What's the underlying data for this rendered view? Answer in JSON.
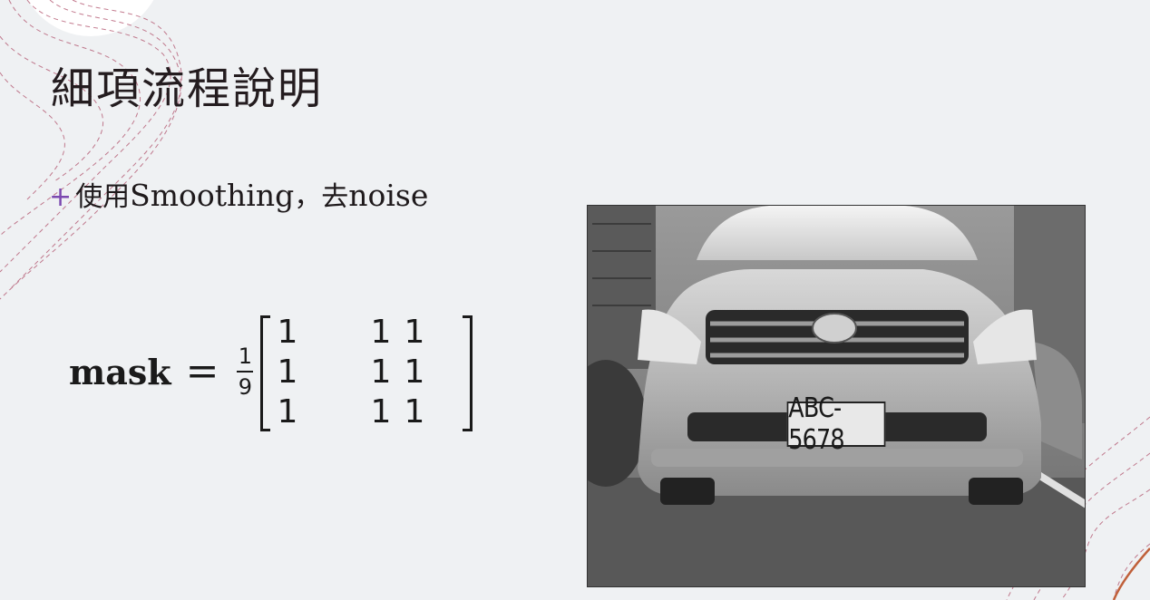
{
  "slide": {
    "title": "細項流程說明",
    "bullet": {
      "marker": "+",
      "text_cjk_1": "使用",
      "text_en_1": "Smoothing",
      "text_cjk_2": "，去",
      "text_en_2": "noise"
    },
    "formula": {
      "lhs": "mask",
      "equals": "=",
      "frac_num": "1",
      "frac_den": "9",
      "matrix": [
        [
          "1",
          "1",
          "1"
        ],
        [
          "1",
          "1",
          "1"
        ],
        [
          "1",
          "1",
          "1"
        ]
      ]
    },
    "photo": {
      "plate_text": "ABC-5678"
    }
  },
  "colors": {
    "background": "#eff1f3",
    "accent_plus": "#7b49b0",
    "deco_line": "#b0506a",
    "deco_corner": "#c0603a"
  }
}
